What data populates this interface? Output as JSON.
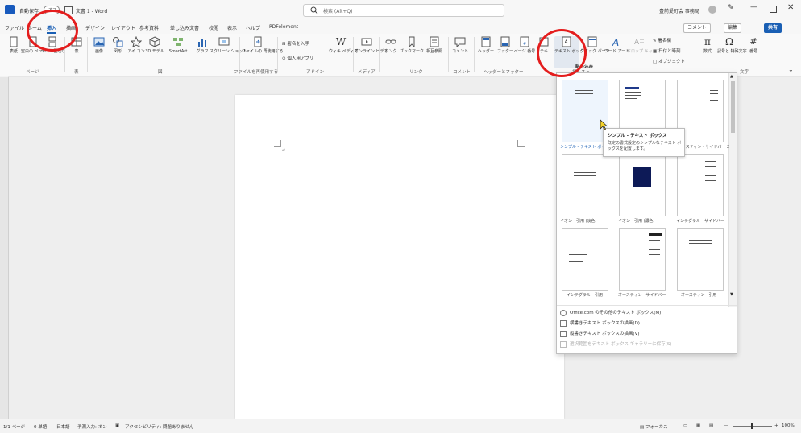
{
  "colors": {
    "accent": "#1a5fb4",
    "annotation": "#e41d1d",
    "word_blue": "#185abd"
  },
  "titlebar": {
    "autosave": "自動保存",
    "autosave_state": "オフ",
    "doc_title": "文書 1 - Word",
    "search_placeholder": "検索 (Alt+Q)",
    "user": "豊前愛町会 事務局"
  },
  "menu": {
    "tabs": [
      "ファイル",
      "ホーム",
      "挿入",
      "描画",
      "デザイン",
      "レイアウト",
      "参考資料",
      "差し込み文書",
      "校閲",
      "表示",
      "ヘルプ",
      "PDFelement"
    ],
    "active_tab": "挿入",
    "comment_btn": "コメント",
    "edit_btn": "編集",
    "share_btn": "共有"
  },
  "ribbon": {
    "buttons": {
      "cover": "表紙",
      "blank": "空白の ページ",
      "pagebreak": "ページ 区切り",
      "table": "表",
      "pictures": "画像",
      "shapes": "図形",
      "icons": "アイ コン",
      "model3d": "3D モデル",
      "smartart": "SmartArt",
      "chart": "グラフ",
      "screenshot": "スクリーン ショット",
      "reuse": "ファイルの 再使用する",
      "signature": "署名を入手",
      "personal_apps": "個人用アプリ",
      "wikipedia": "ウィキ ペディア",
      "online_video": "オンライン ビデオ",
      "link": "リンク",
      "bookmark": "ブックマーク",
      "cross_ref": "相互参照",
      "comment": "コメント",
      "header": "ヘッダー",
      "footer": "フッター",
      "page_number": "ページ 番号",
      "symbol_partial": "テキ",
      "textbox": "テキスト ボックス",
      "quick_parts": "クイック パーツ",
      "wordart": "ワード アート",
      "drop_cap": "ドロップ キャップ",
      "signature_line": "署名欄",
      "date_time": "日付と時刻",
      "object": "オブジェクト",
      "equation": "数式",
      "symbols": "記号と 特殊文字",
      "number": "番号"
    },
    "groups": {
      "pages": "ページ",
      "tables": "表",
      "illustrations": "図",
      "reuse_files": "ファイルを再使用する",
      "addins": "アドイン",
      "media": "メディア",
      "links": "リンク",
      "comments": "コメント",
      "header_footer": "ヘッダーとフッター",
      "text": "挿入スト",
      "symbols": "文字"
    }
  },
  "gallery": {
    "section": "組み込み",
    "items": [
      {
        "label": "シンプル - テキスト ボックス"
      },
      {
        "label": ""
      },
      {
        "label": "オースティン - サイドバー 2"
      },
      {
        "label": "イオン - 引用 (淡色)"
      },
      {
        "label": "イオン - 引用 (濃色)"
      },
      {
        "label": "インテグラル - サイドバー"
      },
      {
        "label": "インテグラル - 引用"
      },
      {
        "label": "オースティン - サイドバー"
      },
      {
        "label": "オースティン - 引用"
      }
    ],
    "menu": [
      "Office.com のその他のテキスト ボックス(M)",
      "横書きテキスト ボックスの描画(D)",
      "縦書きテキスト ボックスの描画(V)",
      "選択範囲をテキスト ボックス ギャラリーに保存(S)"
    ],
    "tooltip_title": "シンプル - テキスト ボックス",
    "tooltip_desc": "既定の書式設定のシンプルなテキスト ボックスを配置します。"
  },
  "statusbar": {
    "page": "1/1 ページ",
    "words": "0 単語",
    "language": "日本語",
    "prediction": "予測入力: オン",
    "accessibility": "アクセシビリティ: 問題ありません",
    "focus": "フォーカス",
    "zoom": "100%"
  }
}
